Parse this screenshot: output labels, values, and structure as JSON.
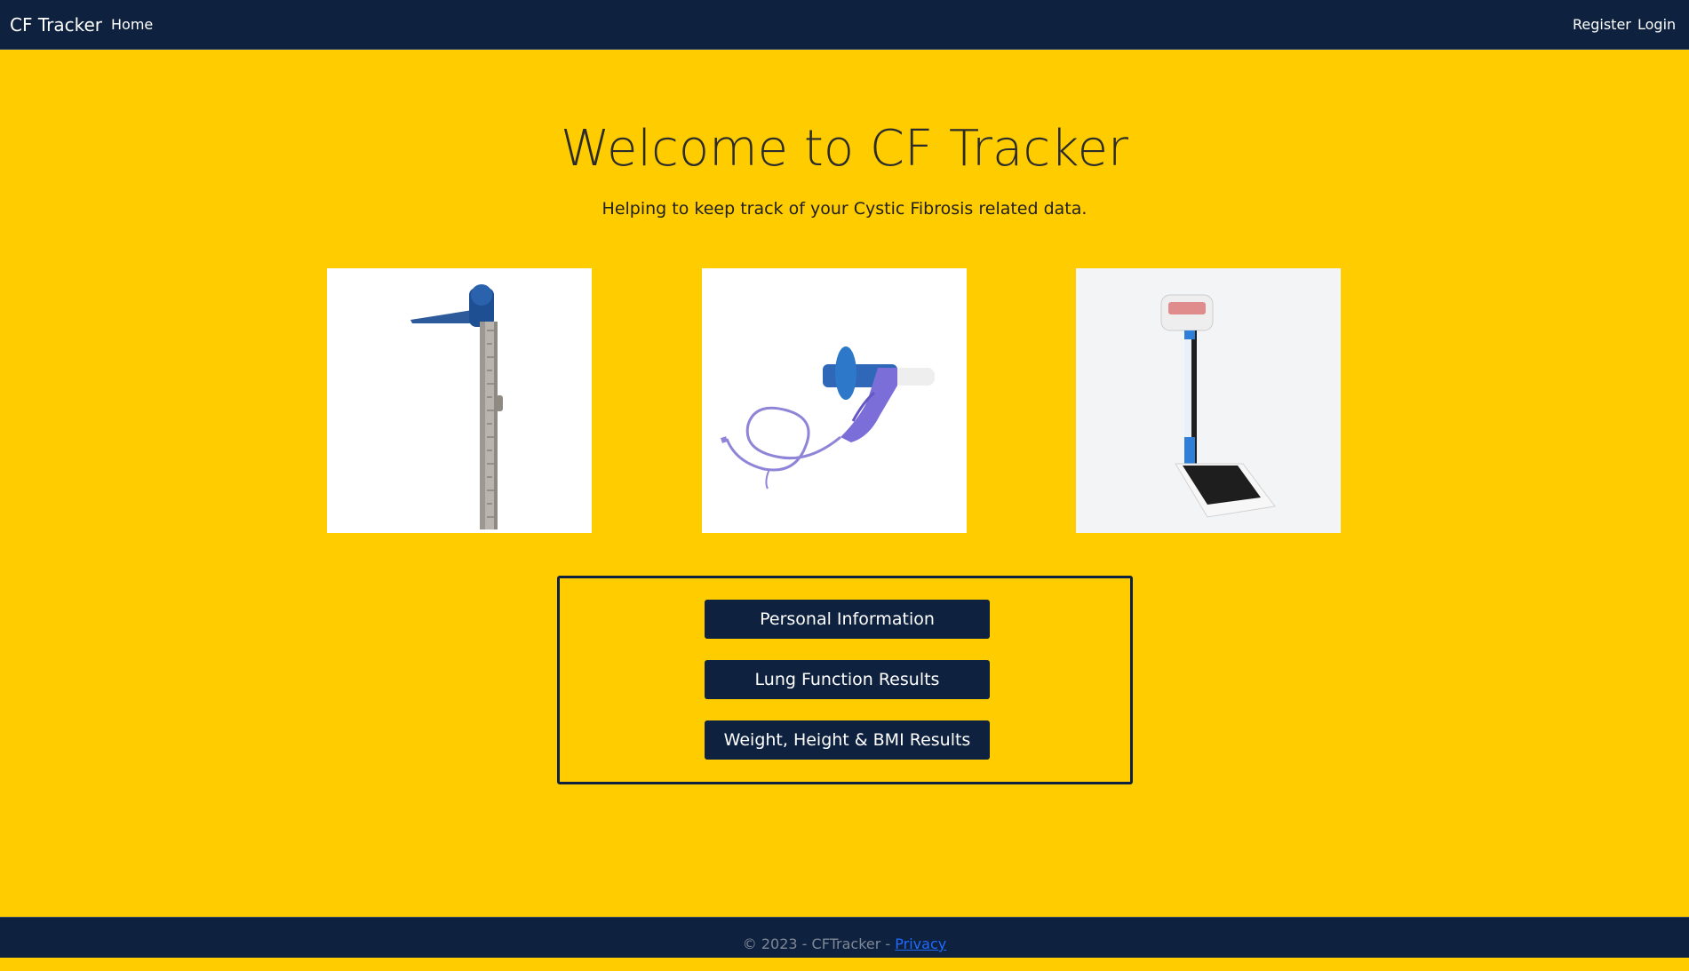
{
  "nav": {
    "brand": "CF Tracker",
    "home": "Home",
    "register": "Register",
    "login": "Login"
  },
  "hero": {
    "title": "Welcome to CF Tracker",
    "subtitle": "Helping to keep track of your Cystic Fibrosis related data."
  },
  "images": [
    {
      "name": "height-measuring-stadiometer"
    },
    {
      "name": "spirometer-device"
    },
    {
      "name": "weighing-scale"
    }
  ],
  "actions": {
    "personal": "Personal Information",
    "lung": "Lung Function Results",
    "weight": "Weight, Height & BMI Results"
  },
  "footer": {
    "copyright": "© 2023 - CFTracker - ",
    "privacy": "Privacy"
  },
  "colors": {
    "background": "#ffcc00",
    "navbar": "#0e213f",
    "button": "#0e213f",
    "link": "#1e6bff"
  }
}
